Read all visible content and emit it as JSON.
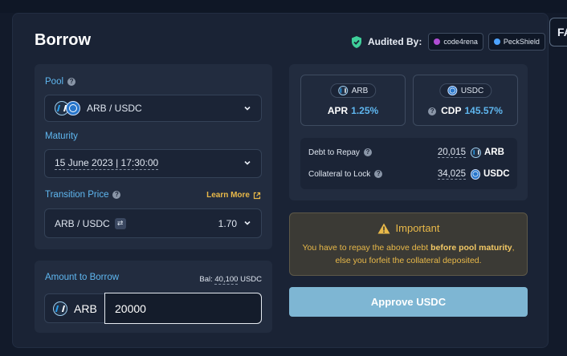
{
  "header": {
    "title": "Borrow",
    "audited_label": "Audited By:",
    "auditors": [
      {
        "name": "code4rena",
        "color": "#b04dd4"
      },
      {
        "name": "PeckShield",
        "color": "#4da3ff"
      }
    ],
    "side_tab": "FA"
  },
  "pool": {
    "label": "Pool",
    "value": "ARB / USDC"
  },
  "maturity": {
    "label": "Maturity",
    "value": "15 June 2023 | 17:30:00"
  },
  "transition_price": {
    "label": "Transition Price",
    "learn_more": "Learn More",
    "pair": "ARB / USDC",
    "value": "1.70"
  },
  "amount": {
    "label": "Amount to Borrow",
    "balance_label": "Bal:",
    "balance_value": "40,100",
    "balance_token": "USDC",
    "token": "ARB",
    "input_value": "20000"
  },
  "stats": {
    "arb": {
      "token": "ARB",
      "metric": "APR",
      "value": "1.25%"
    },
    "usdc": {
      "token": "USDC",
      "metric": "CDP",
      "value": "145.57%"
    }
  },
  "summary": {
    "debt_label": "Debt to Repay",
    "debt_value": "20,015",
    "debt_token": "ARB",
    "collateral_label": "Collateral to Lock",
    "collateral_value": "34,025",
    "collateral_token": "USDC"
  },
  "important": {
    "title": "Important",
    "text_1": "You have to repay the above debt ",
    "text_bold": "before pool maturity",
    "text_2": ", else you forfeit the collateral deposited."
  },
  "approve_button": "Approve USDC",
  "colors": {
    "accent_blue": "#5fb7f0",
    "warning": "#e9b949",
    "button": "#7eb6d3"
  }
}
